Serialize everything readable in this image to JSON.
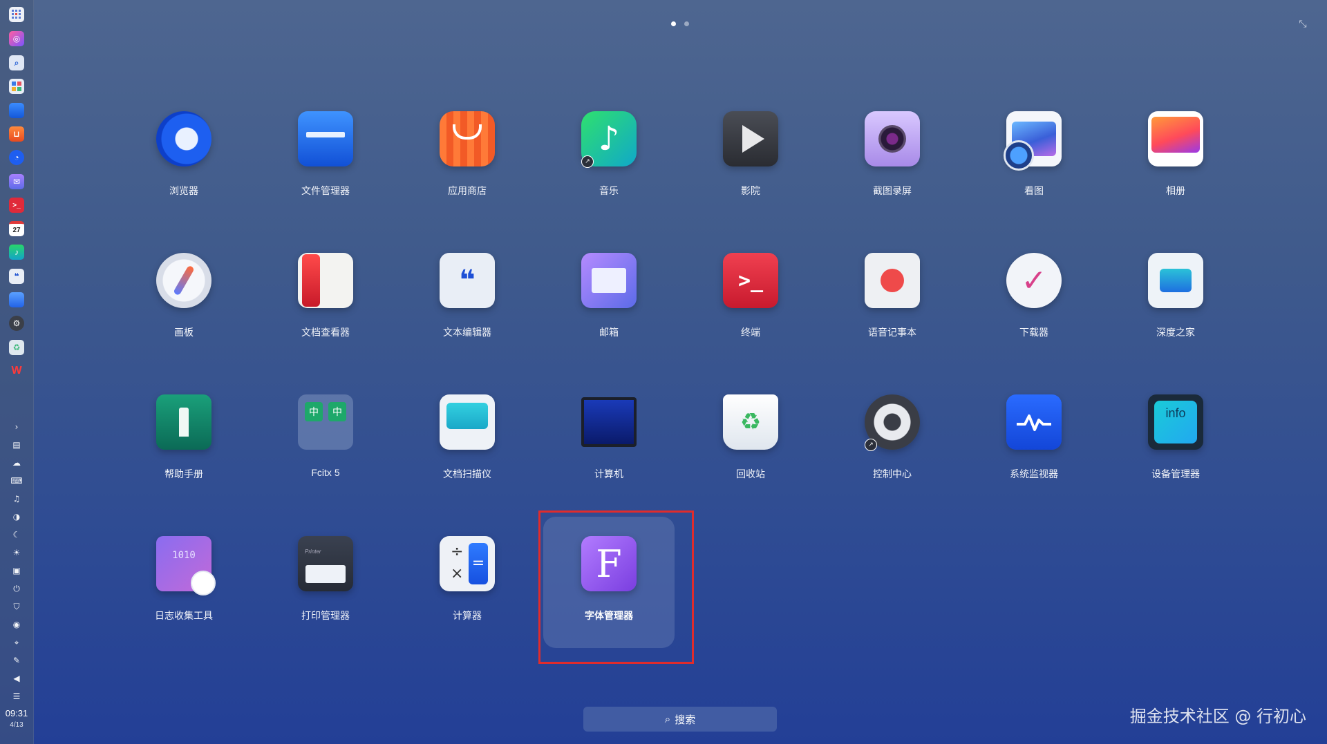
{
  "pager": {
    "pages": 2,
    "current": 1
  },
  "apps": [
    {
      "label": "浏览器",
      "icon": "browser-icon"
    },
    {
      "label": "文件管理器",
      "icon": "file-manager-icon"
    },
    {
      "label": "应用商店",
      "icon": "app-store-icon"
    },
    {
      "label": "音乐",
      "icon": "music-icon"
    },
    {
      "label": "影院",
      "icon": "movie-icon"
    },
    {
      "label": "截图录屏",
      "icon": "screenshot-icon"
    },
    {
      "label": "看图",
      "icon": "image-viewer-icon"
    },
    {
      "label": "相册",
      "icon": "album-icon"
    },
    {
      "label": "画板",
      "icon": "draw-icon"
    },
    {
      "label": "文档查看器",
      "icon": "document-viewer-icon"
    },
    {
      "label": "文本编辑器",
      "icon": "text-editor-icon"
    },
    {
      "label": "邮箱",
      "icon": "mail-icon"
    },
    {
      "label": "终端",
      "icon": "terminal-icon"
    },
    {
      "label": "语音记事本",
      "icon": "voice-note-icon"
    },
    {
      "label": "下载器",
      "icon": "downloader-icon"
    },
    {
      "label": "深度之家",
      "icon": "deepin-home-icon"
    },
    {
      "label": "帮助手册",
      "icon": "manual-icon"
    },
    {
      "label": "Fcitx 5",
      "icon": "fcitx-icon"
    },
    {
      "label": "文档扫描仪",
      "icon": "scanner-icon"
    },
    {
      "label": "计算机",
      "icon": "computer-icon"
    },
    {
      "label": "回收站",
      "icon": "trash-icon"
    },
    {
      "label": "控制中心",
      "icon": "control-center-icon"
    },
    {
      "label": "系统监视器",
      "icon": "system-monitor-icon"
    },
    {
      "label": "设备管理器",
      "icon": "device-manager-icon"
    },
    {
      "label": "日志收集工具",
      "icon": "log-collector-icon"
    },
    {
      "label": "打印管理器",
      "icon": "print-manager-icon"
    },
    {
      "label": "计算器",
      "icon": "calculator-icon"
    },
    {
      "label": "字体管理器",
      "icon": "font-manager-icon"
    }
  ],
  "icon_text": {
    "device_manager": "info",
    "font_manager": "F",
    "fcitx": "中",
    "calendar_day": "27",
    "printer": "Printer",
    "log_digits": "1010"
  },
  "selected_app": "字体管理器",
  "search": {
    "label": "搜索"
  },
  "dock": {
    "time": "09:31",
    "date": "4/13"
  },
  "watermark": "掘金技术社区 @ 行初心",
  "colors": {
    "highlight": "#e02c2c",
    "background": "#3f5a8c"
  }
}
